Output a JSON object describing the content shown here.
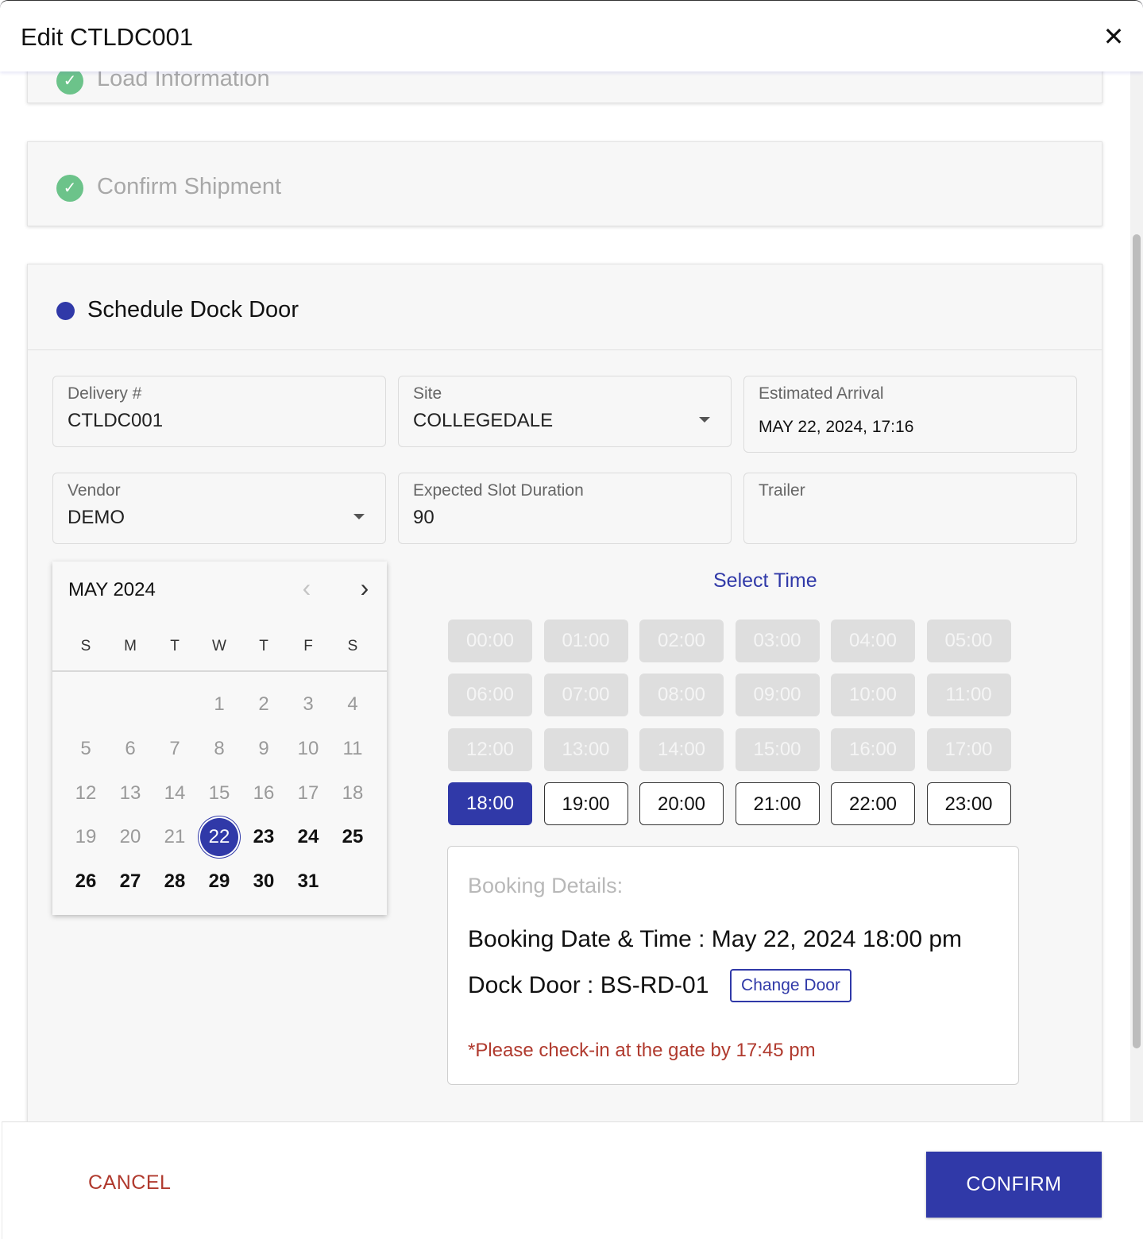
{
  "dialog": {
    "title": "Edit CTLDC001",
    "close_symbol": "✕"
  },
  "steps": {
    "load_information": {
      "label": "Load Information",
      "status": "complete"
    },
    "confirm_shipment": {
      "label": "Confirm Shipment",
      "status": "complete"
    },
    "schedule_dock_door": {
      "label": "Schedule Dock Door",
      "status": "active"
    }
  },
  "check_symbol": "✓",
  "fields": {
    "delivery": {
      "label": "Delivery #",
      "value": "CTLDC001"
    },
    "site": {
      "label": "Site",
      "value": "COLLEGEDALE"
    },
    "estimated_arrival": {
      "label": "Estimated Arrival",
      "value": "MAY 22, 2024, 17:16"
    },
    "vendor": {
      "label": "Vendor",
      "value": "DEMO"
    },
    "expected_slot_duration": {
      "label": "Expected Slot Duration",
      "value": "90"
    },
    "trailer": {
      "label": "Trailer",
      "value": ""
    }
  },
  "calendar": {
    "month_label": "MAY 2024",
    "prev_symbol": "‹",
    "next_symbol": "›",
    "weekdays": [
      "S",
      "M",
      "T",
      "W",
      "T",
      "F",
      "S"
    ],
    "first_weekday_index": 3,
    "days_in_month": 31,
    "selected_day": 22
  },
  "time_selector": {
    "title": "Select Time",
    "slots": [
      {
        "label": "00:00",
        "state": "disabled"
      },
      {
        "label": "01:00",
        "state": "disabled"
      },
      {
        "label": "02:00",
        "state": "disabled"
      },
      {
        "label": "03:00",
        "state": "disabled"
      },
      {
        "label": "04:00",
        "state": "disabled"
      },
      {
        "label": "05:00",
        "state": "disabled"
      },
      {
        "label": "06:00",
        "state": "disabled"
      },
      {
        "label": "07:00",
        "state": "disabled"
      },
      {
        "label": "08:00",
        "state": "disabled"
      },
      {
        "label": "09:00",
        "state": "disabled"
      },
      {
        "label": "10:00",
        "state": "disabled"
      },
      {
        "label": "11:00",
        "state": "disabled"
      },
      {
        "label": "12:00",
        "state": "disabled"
      },
      {
        "label": "13:00",
        "state": "disabled"
      },
      {
        "label": "14:00",
        "state": "disabled"
      },
      {
        "label": "15:00",
        "state": "disabled"
      },
      {
        "label": "16:00",
        "state": "disabled"
      },
      {
        "label": "17:00",
        "state": "disabled"
      },
      {
        "label": "18:00",
        "state": "selected"
      },
      {
        "label": "19:00",
        "state": "available"
      },
      {
        "label": "20:00",
        "state": "available"
      },
      {
        "label": "21:00",
        "state": "available"
      },
      {
        "label": "22:00",
        "state": "available"
      },
      {
        "label": "23:00",
        "state": "available"
      }
    ]
  },
  "booking": {
    "title": "Booking Details:",
    "date_time": "Booking Date & Time : May 22, 2024 18:00 pm",
    "dock_door": "Dock Door : BS-RD-01",
    "change_door_label": "Change Door",
    "checkin_note": "*Please check-in at the gate by 17:45 pm"
  },
  "footer": {
    "cancel_label": "CANCEL",
    "confirm_label": "CONFIRM"
  },
  "colors": {
    "primary": "#3039a8",
    "success": "#6cc38a",
    "danger": "#b03a2e",
    "disabled_slot": "#dedede"
  }
}
